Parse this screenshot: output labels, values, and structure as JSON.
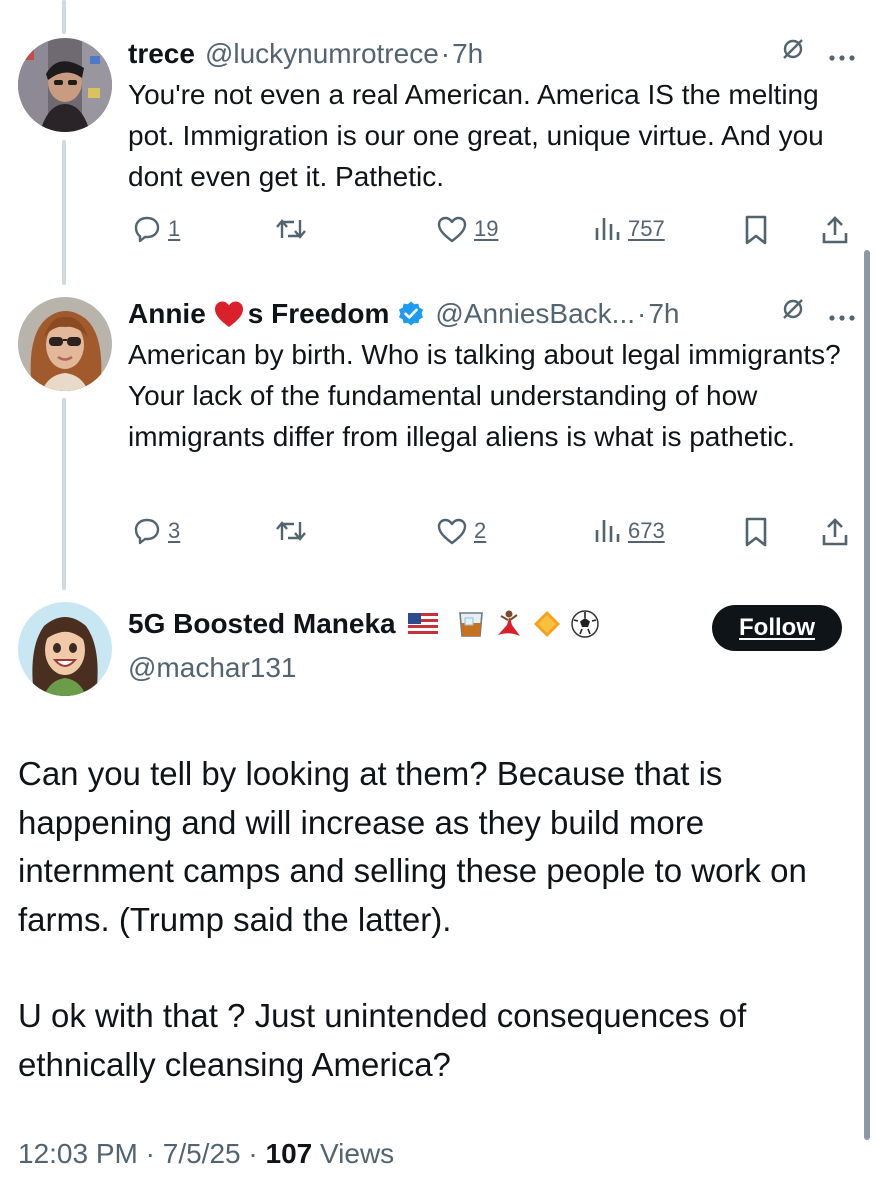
{
  "replies": [
    {
      "name": "trece",
      "handle": "@luckynumrotrece",
      "time": "7h",
      "text": "You're not even a real American. America IS the melting pot. Immigration is our one great, unique virtue. And you dont even get it. Pathetic.",
      "stats": {
        "replies": "1",
        "likes": "19",
        "views": "757"
      }
    },
    {
      "name_part1": "Annie",
      "name_part2": "s Freedom",
      "handle": "@AnniesBack...",
      "time": "7h",
      "text": "American by birth.  Who is talking about legal immigrants?  Your lack of the fundamental understanding of how immigrants differ from illegal aliens is what is pathetic.",
      "stats": {
        "replies": "3",
        "likes": "2",
        "views": "673"
      }
    }
  ],
  "main_post": {
    "name": "5G Boosted Maneka",
    "handle": "@machar131",
    "follow_label": "Follow",
    "paragraph1": "Can you tell by looking at them? Because that is happening and will increase as they build more internment camps and selling these people to work on farms. (Trump said the latter).",
    "paragraph2": "U ok with that ? Just unintended consequences of ethnically cleansing America?",
    "time": "12:03 PM",
    "date": "7/5/25",
    "views_count": "107",
    "views_label": "Views"
  },
  "separator": "·",
  "icons": {
    "more": "more-icon",
    "grok": "grok-slash-icon",
    "reply": "reply-icon",
    "repost": "repost-icon",
    "like": "heart-icon",
    "views": "bar-chart-icon",
    "bookmark": "bookmark-icon",
    "share": "share-icon",
    "verified": "verified-badge-icon"
  },
  "colors": {
    "verified": "#1d9bf0",
    "heart": "#d9202b",
    "text_secondary": "#536471"
  }
}
